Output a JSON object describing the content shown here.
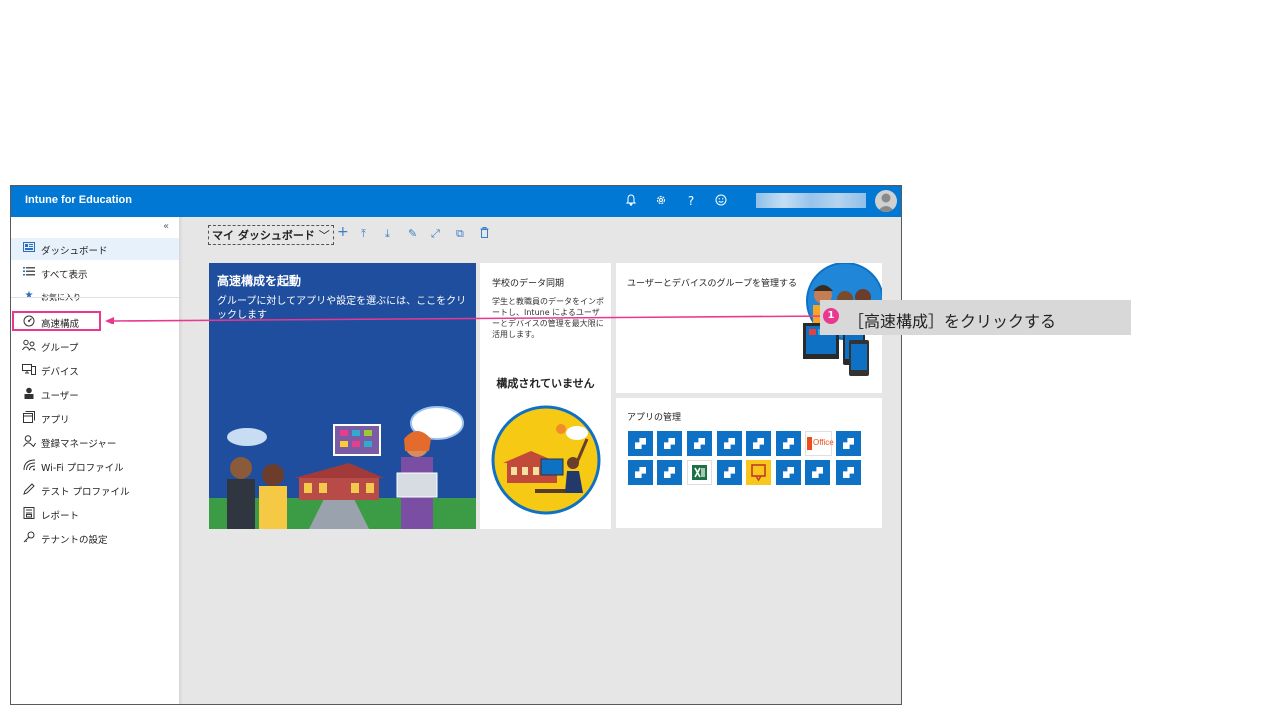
{
  "header": {
    "app_title": "Intune for Education",
    "icons": [
      "bell-icon",
      "gear-icon",
      "help-icon",
      "smiley-icon"
    ],
    "help_glyph": "?"
  },
  "sidebar": {
    "collapse_glyph": "«",
    "items": [
      {
        "label": "ダッシュボード",
        "icon": "dashboard-icon"
      },
      {
        "label": "すべて表示",
        "icon": "list-icon"
      },
      {
        "label": "お気に入り",
        "icon": "star-icon"
      },
      {
        "label": "高速構成",
        "icon": "gauge-icon"
      },
      {
        "label": "グループ",
        "icon": "group-icon"
      },
      {
        "label": "デバイス",
        "icon": "devices-icon"
      },
      {
        "label": "ユーザー",
        "icon": "user-icon"
      },
      {
        "label": "アプリ",
        "icon": "apps-icon"
      },
      {
        "label": "登録マネージャー",
        "icon": "enrollment-manager-icon"
      },
      {
        "label": "Wi-Fi プロファイル",
        "icon": "wifi-icon"
      },
      {
        "label": "テスト プロファイル",
        "icon": "pen-icon"
      },
      {
        "label": "レポート",
        "icon": "report-icon"
      },
      {
        "label": "テナントの設定",
        "icon": "key-icon"
      }
    ]
  },
  "dashboard": {
    "title": "マイ ダッシュボード",
    "toolbar_icons": [
      "add-icon",
      "move-top-icon",
      "download-icon",
      "edit-icon",
      "expand-icon",
      "clone-icon",
      "delete-icon"
    ]
  },
  "tiles": {
    "hero": {
      "title": "高速構成を起動",
      "text": "グループに対してアプリや設定を選ぶには、ここをクリックします"
    },
    "sync": {
      "title": "学校のデータ同期",
      "description": "学生と教職員のデータをインポートし、Intune によるユーザーとデバイスの管理を最大限に活用します。",
      "status": "構成されていません"
    },
    "groups": {
      "title": "ユーザーとデバイスのグループを管理する"
    },
    "apps": {
      "title": "アプリの管理",
      "office_label": "Office"
    }
  },
  "annotation": {
    "step_number": "1",
    "text": "［高速構成］をクリックする",
    "color": "#e8388f"
  },
  "colors": {
    "topbar": "#0078d4",
    "hero_tile": "#1f4e9e",
    "app_tile": "#0f71c4"
  }
}
